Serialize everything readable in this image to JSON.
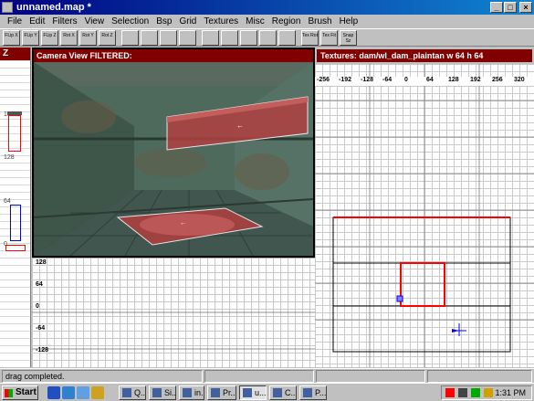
{
  "window": {
    "title": "unnamed.map *",
    "min": "_",
    "max": "□",
    "close": "×"
  },
  "menu": [
    "File",
    "Edit",
    "Filters",
    "View",
    "Selection",
    "Bsp",
    "Grid",
    "Textures",
    "Misc",
    "Region",
    "Brush",
    "Help"
  ],
  "toolbar": [
    {
      "label": "FLip X",
      "icon": "flip-x-icon"
    },
    {
      "label": "FLip Y",
      "icon": "flip-y-icon"
    },
    {
      "label": "FLip Z",
      "icon": "flip-z-icon"
    },
    {
      "label": "Rot X",
      "icon": "rotate-x-icon"
    },
    {
      "label": "Rot Y",
      "icon": "rotate-y-icon"
    },
    {
      "label": "Rot Z",
      "icon": "rotate-z-icon"
    },
    {
      "label": "",
      "icon": "select-complete-tall-icon"
    },
    {
      "label": "",
      "icon": "select-touching-icon"
    },
    {
      "label": "",
      "icon": "select-partial-tall-icon"
    },
    {
      "label": "",
      "icon": "select-inside-icon"
    },
    {
      "label": "",
      "icon": "csg-subtract-icon"
    },
    {
      "label": "",
      "icon": "csg-merge-icon"
    },
    {
      "label": "",
      "icon": "clipper-icon"
    },
    {
      "label": "",
      "icon": "texture-lock-icon"
    },
    {
      "label": "",
      "icon": "entity-icon"
    },
    {
      "label": "Tex Rot",
      "icon": "texture-rotate-icon"
    },
    {
      "label": "Tex Fit",
      "icon": "texture-fit-icon"
    },
    {
      "label": "Snap Sz",
      "icon": "snap-size-icon"
    }
  ],
  "z_panel": {
    "header": "Z",
    "labels": [
      "192",
      "128",
      "64",
      "0"
    ]
  },
  "camera": {
    "header": "Camera View FILTERED:"
  },
  "texture_bar": {
    "text": "Textures: dam/wl_dam_plaintan w 64 h 64"
  },
  "xy_grid": {
    "x_ticks": [
      "-256",
      "-192",
      "-128",
      "-64",
      "0",
      "64",
      "128",
      "192",
      "256",
      "320"
    ],
    "y_ticks": [
      "128",
      "64",
      "0",
      "-64",
      "-128"
    ]
  },
  "status": {
    "message": "drag completed."
  },
  "taskbar": {
    "start": "Start",
    "tasks": [
      "Q...",
      "Si...",
      "in...",
      "Pr...",
      "u...",
      "C...",
      "P..."
    ],
    "active_index": 4,
    "clock": "1:31 PM"
  },
  "colors": {
    "title_start": "#000080",
    "title_end": "#1084d0",
    "panel_header": "#800000",
    "selected_brush": "#ff0000"
  }
}
